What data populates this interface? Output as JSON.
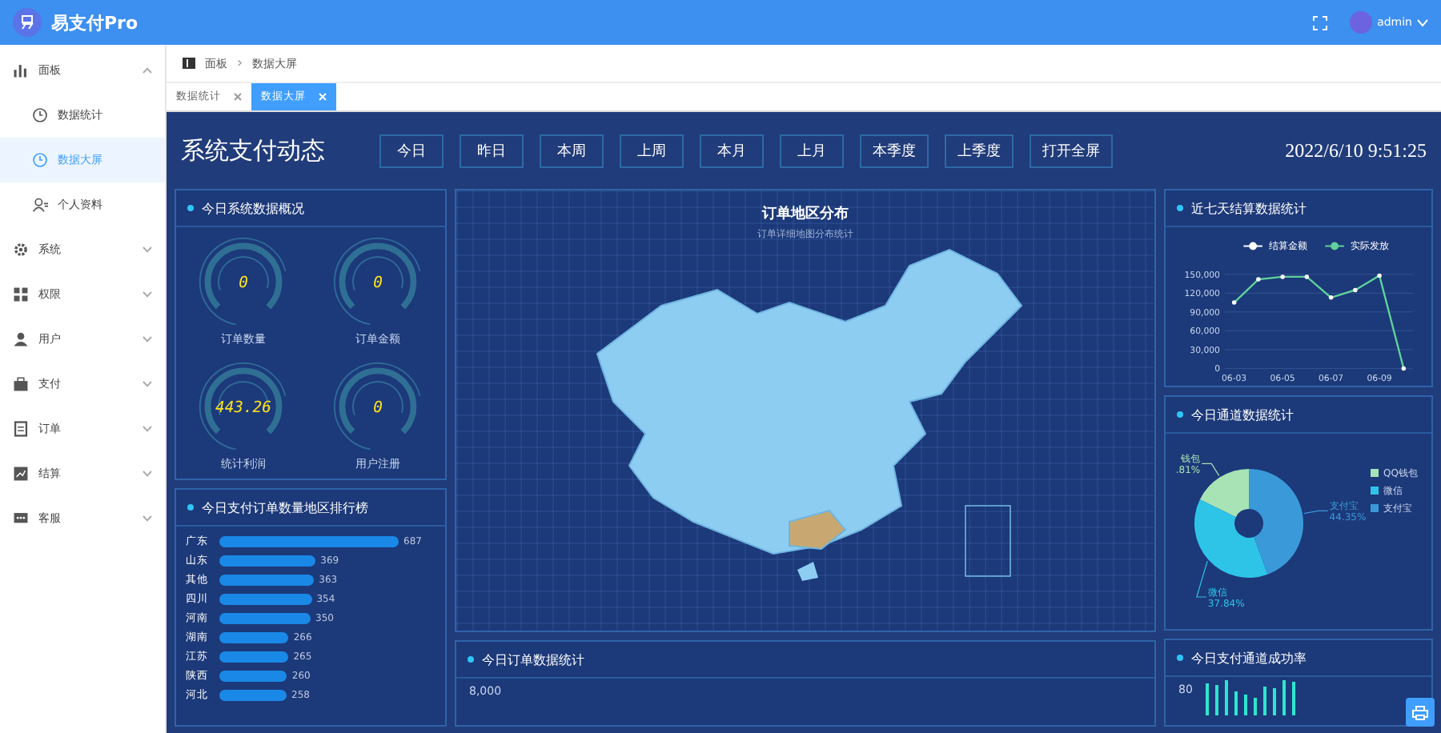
{
  "header": {
    "app_name": "易支付Pro",
    "user": "admin"
  },
  "sidebar": {
    "items": [
      {
        "label": "面板",
        "expanded": true,
        "children": [
          {
            "label": "数据统计",
            "selected": false
          },
          {
            "label": "数据大屏",
            "selected": true
          },
          {
            "label": "个人资料",
            "selected": false
          }
        ]
      },
      {
        "label": "系统",
        "expanded": false
      },
      {
        "label": "权限",
        "expanded": false
      },
      {
        "label": "用户",
        "expanded": false
      },
      {
        "label": "支付",
        "expanded": false
      },
      {
        "label": "订单",
        "expanded": false
      },
      {
        "label": "结算",
        "expanded": false
      },
      {
        "label": "客服",
        "expanded": false
      }
    ]
  },
  "breadcrumb": {
    "items": [
      "面板",
      "数据大屏"
    ],
    "separator": "›"
  },
  "tabs": [
    {
      "label": "数据统计",
      "selected": false
    },
    {
      "label": "数据大屏",
      "selected": true
    }
  ],
  "dashboard": {
    "title": "系统支付动态",
    "datetime": "2022/6/10 9:51:25",
    "periods": [
      {
        "label": "今日",
        "selected": false
      },
      {
        "label": "昨日",
        "selected": false
      },
      {
        "label": "本周",
        "selected": false
      },
      {
        "label": "上周",
        "selected": false
      },
      {
        "label": "本月",
        "selected": false
      },
      {
        "label": "上月",
        "selected": false
      },
      {
        "label": "本季度",
        "selected": false
      },
      {
        "label": "上季度",
        "selected": false
      },
      {
        "label": "打开全屏",
        "selected": false
      }
    ],
    "overview": {
      "title": "今日系统数据概况",
      "gauges": [
        {
          "label": "订单数量",
          "value": "0"
        },
        {
          "label": "订单金额",
          "value": "0"
        },
        {
          "label": "统计利润",
          "value": "443.26"
        },
        {
          "label": "用户注册",
          "value": "0"
        }
      ]
    },
    "ranking": {
      "title": "今日支付订单数量地区排行榜",
      "chart_data": {
        "type": "bar",
        "orientation": "horizontal",
        "categories": [
          "广东",
          "山东",
          "其他",
          "四川",
          "河南",
          "湖南",
          "江苏",
          "陕西",
          "河北"
        ],
        "values": [
          687,
          369,
          363,
          354,
          350,
          266,
          265,
          260,
          258
        ],
        "data_labels": true
      }
    },
    "map": {
      "title": "订单地区分布",
      "subtitle": "订单详细地图分布统计"
    },
    "orders": {
      "title": "今日订单数据统计",
      "tick": "8,000"
    },
    "settlement": {
      "title": "近七天结算数据统计",
      "chart_data": {
        "type": "line",
        "categories": [
          "06-03",
          null,
          "06-05",
          null,
          "06-07",
          null,
          "06-09",
          null
        ],
        "ylim": [
          0,
          150000
        ],
        "grid": true,
        "legend": true,
        "series": [
          {
            "name": "结算金额",
            "color": "#ffffff",
            "values": [
              null,
              null,
              null,
              null,
              null,
              null,
              null,
              null
            ]
          },
          {
            "name": "实际发放",
            "color": "#5fd39a",
            "values": [
              105000,
              142000,
              146000,
              146000,
              113000,
              125000,
              148000,
              0
            ]
          }
        ],
        "yticks": [
          {
            "value": 0,
            "label": "0"
          },
          {
            "value": 30000,
            "label": "30,000"
          },
          {
            "value": 60000,
            "label": "60,000"
          },
          {
            "value": 90000,
            "label": "90,000"
          },
          {
            "value": 120000,
            "label": "120,000"
          },
          {
            "value": 150000,
            "label": "150,000"
          }
        ]
      }
    },
    "channels": {
      "title": "今日通道数据统计",
      "chart_data": {
        "type": "donut",
        "legend": true,
        "categories": [
          "QQ钱包",
          "微信",
          "支付宝"
        ],
        "colors": [
          "#a7e3b5",
          "#2ec4e8",
          "#3a9ad9"
        ],
        "values": [
          17.81,
          37.84,
          44.35
        ]
      },
      "callouts": [
        {
          "name": "钱包",
          "percent": ".81%"
        },
        {
          "name": "微信",
          "percent": "37.84%"
        },
        {
          "name": "支付宝",
          "percent": "44.35%"
        }
      ]
    },
    "success": {
      "title": "今日支付通道成功率",
      "tick": "80"
    }
  }
}
